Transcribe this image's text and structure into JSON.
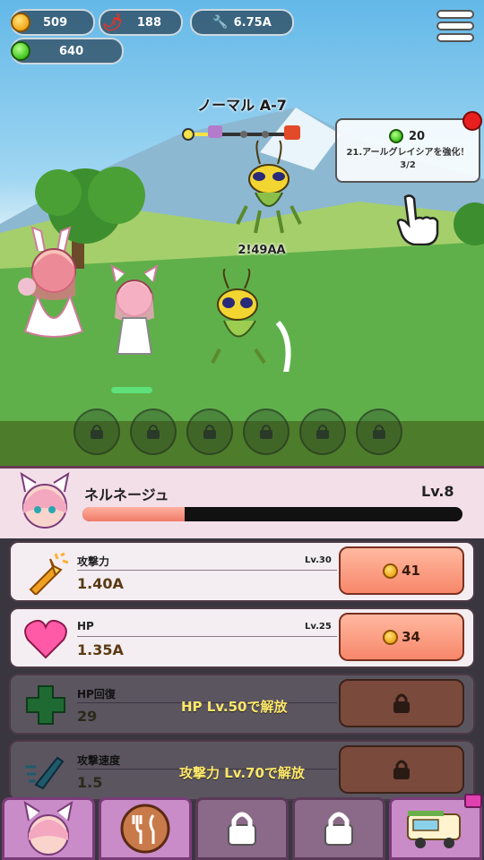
{
  "hud": {
    "coins": "509",
    "pepper": "188",
    "power": "6.75A",
    "gems": "640"
  },
  "stage": {
    "title": "ノーマル A-7",
    "enemy_hp": "2!49AA"
  },
  "quest": {
    "reward": "20",
    "text": "21.アールグレイシアを強化！ 3/2"
  },
  "character": {
    "name": "ネルネージュ",
    "level": "Lv.8",
    "exp_fraction": 0.27
  },
  "upgrades": [
    {
      "title": "攻撃力",
      "level": "Lv.30",
      "value": "1.40A",
      "cost": "41",
      "icon": "sword-icon"
    },
    {
      "title": "HP",
      "level": "Lv.25",
      "value": "1.35A",
      "cost": "34",
      "icon": "heart-icon"
    },
    {
      "title": "HP回復",
      "value": "29",
      "lock": "HP Lv.50で解放",
      "icon": "cross-icon"
    },
    {
      "title": "攻撃速度",
      "value": "1.5",
      "lock": "攻撃力 Lv.70で解放",
      "icon": "speed-icon"
    }
  ],
  "colors": {
    "accent_pink": "#c98cc8",
    "buy_button": "#f7876a",
    "locked_button": "#7a4a3c"
  }
}
